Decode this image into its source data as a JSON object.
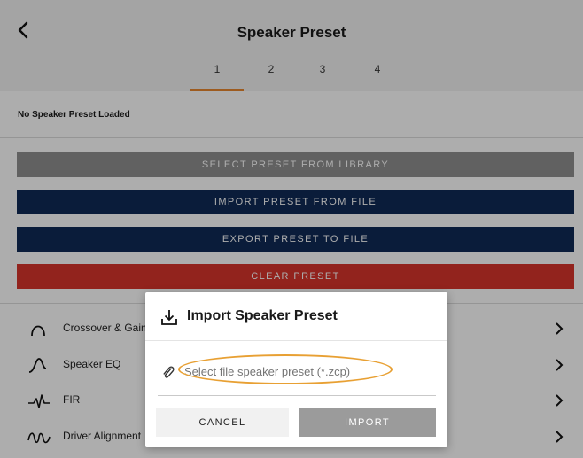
{
  "header": {
    "title": "Speaker Preset",
    "tabs": [
      "1",
      "2",
      "3",
      "4"
    ],
    "active_tab": "1"
  },
  "status_text": "No Speaker Preset Loaded",
  "buttons": {
    "select_library": "SELECT PRESET FROM LIBRARY",
    "import_file": "IMPORT PRESET FROM FILE",
    "export_file": "EXPORT PRESET TO FILE",
    "clear": "CLEAR PRESET"
  },
  "menu": [
    {
      "label": "Crossover & Gain",
      "icon": "crossover-curve-icon"
    },
    {
      "label": "Speaker EQ",
      "icon": "eq-curve-icon"
    },
    {
      "label": "FIR",
      "icon": "fir-waveform-icon"
    },
    {
      "label": "Driver Alignment",
      "icon": "driver-alignment-icon"
    }
  ],
  "dialog": {
    "title": "Import Speaker Preset",
    "file_placeholder": "Select file speaker preset (*.zcp)",
    "cancel_label": "CANCEL",
    "import_label": "IMPORT"
  },
  "colors": {
    "accent": "#e8872f",
    "select_btn": "#8f8f8f",
    "navy_btn": "#0f2a56",
    "clear_btn": "#d7342c",
    "import_btn_disabled": "#9b9b9b"
  }
}
